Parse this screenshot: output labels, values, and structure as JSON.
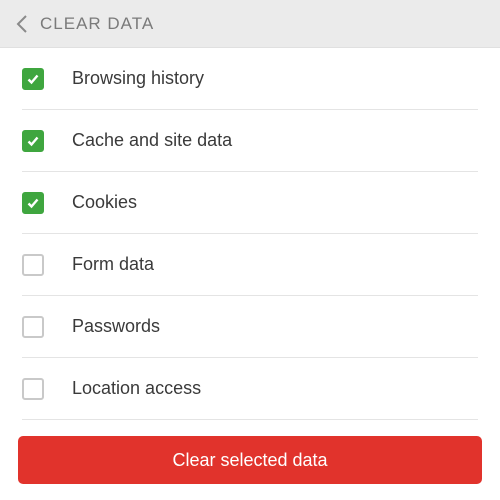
{
  "header": {
    "title": "CLEAR DATA"
  },
  "items": [
    {
      "label": "Browsing history",
      "checked": true
    },
    {
      "label": "Cache and site data",
      "checked": true
    },
    {
      "label": "Cookies",
      "checked": true
    },
    {
      "label": "Form data",
      "checked": false
    },
    {
      "label": "Passwords",
      "checked": false
    },
    {
      "label": "Location access",
      "checked": false
    }
  ],
  "footer": {
    "clear_button": "Clear selected data"
  },
  "colors": {
    "accent_checked": "#3fa63f",
    "danger": "#e1332c",
    "header_bg": "#ebebeb"
  }
}
